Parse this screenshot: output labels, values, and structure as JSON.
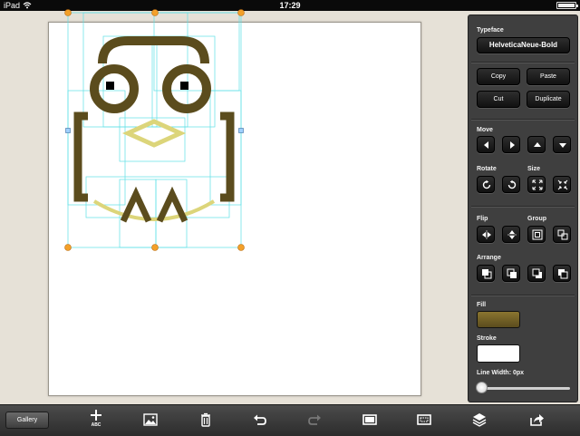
{
  "status_bar": {
    "carrier": "iPad",
    "time": "17:29"
  },
  "inspector": {
    "typeface_label": "Typeface",
    "typeface_value": "HelveticaNeue-Bold",
    "copy": "Copy",
    "paste": "Paste",
    "cut": "Cut",
    "duplicate": "Duplicate",
    "move_label": "Move",
    "rotate_label": "Rotate",
    "size_label": "Size",
    "flip_label": "Flip",
    "group_label": "Group",
    "arrange_label": "Arrange",
    "fill_label": "Fill",
    "stroke_label": "Stroke",
    "line_width_label": "Line Width: 0px",
    "line_width_value": 0,
    "fill_color": "#6b5a22",
    "stroke_color": "#ffffff"
  },
  "toolbar": {
    "gallery": "Gallery",
    "add_text_caption": "ABC",
    "icons": [
      "add-text-icon",
      "insert-image-icon",
      "trash-icon",
      "undo-icon",
      "redo-icon",
      "rectangle-icon",
      "frame-icon",
      "layers-icon",
      "share-icon"
    ]
  },
  "colors": {
    "shape_dark": "#5b4c1d",
    "shape_light": "#dcd57a",
    "selection": "#5ee0e6",
    "handle": "#f3a02a"
  }
}
